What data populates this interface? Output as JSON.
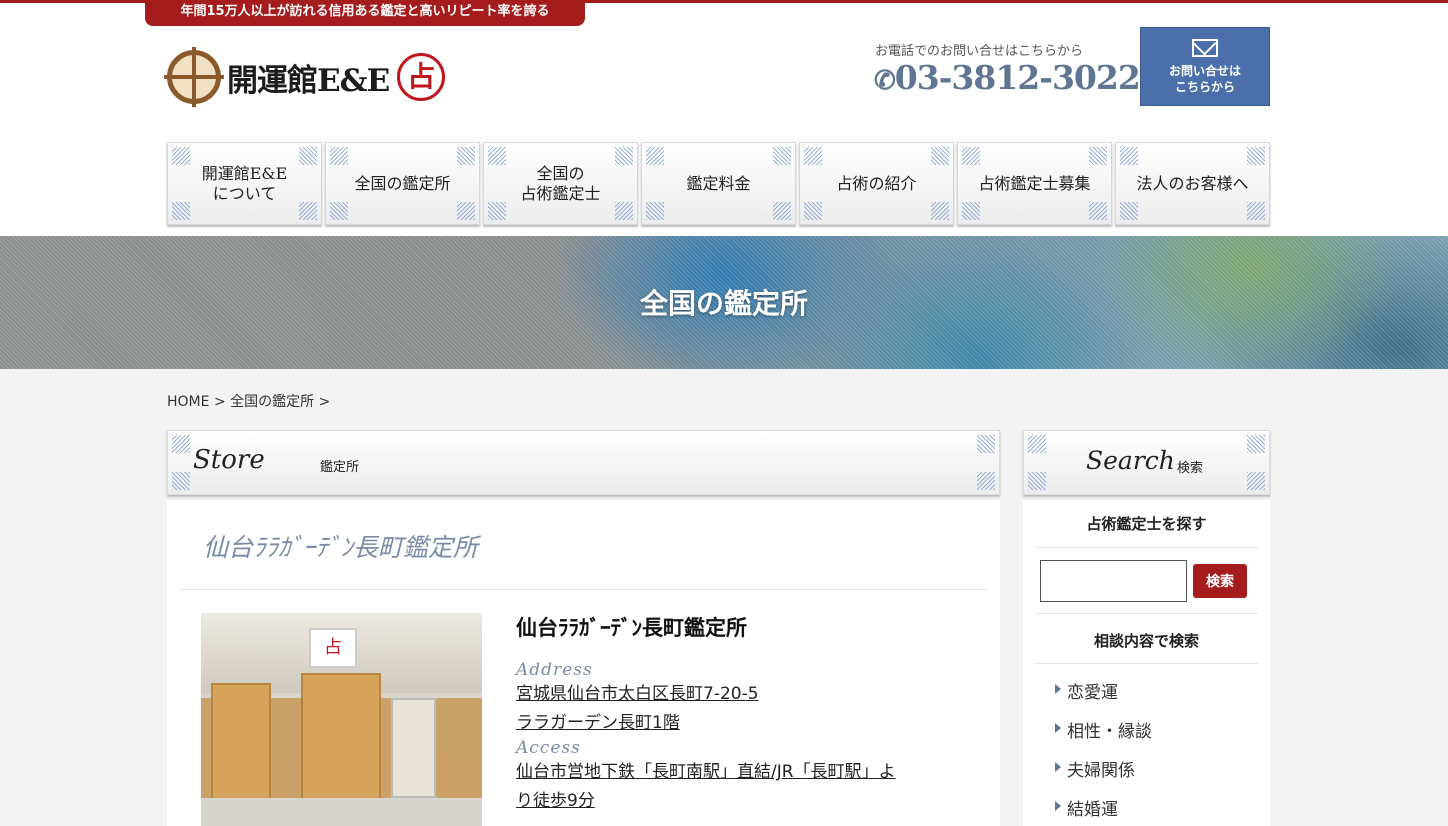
{
  "header": {
    "tagline": "年間15万人以上が訪れる信用ある鑑定と高いリピート率を誇る",
    "logo_text": "開運館E&E",
    "logo_seal": "占",
    "phone_caption": "お電話でのお問い合せはこちらから",
    "phone_number": "03-3812-3022",
    "contact_button_line1": "お問い合せは",
    "contact_button_line2": "こちらから"
  },
  "nav": {
    "items": [
      {
        "label": "開運館E&E\nについて"
      },
      {
        "label": "全国の鑑定所"
      },
      {
        "label": "全国の\n占術鑑定士"
      },
      {
        "label": "鑑定料金"
      },
      {
        "label": "占術の紹介"
      },
      {
        "label": "占術鑑定士募集"
      },
      {
        "label": "法人のお客様へ"
      }
    ]
  },
  "hero": {
    "title": "全国の鑑定所"
  },
  "breadcrumb": {
    "home": "HOME",
    "sep1": ">",
    "current": "全国の鑑定所",
    "sep2": ">"
  },
  "store_section": {
    "heading_en": "Store",
    "heading_ja": "鑑定所",
    "title": "仙台ﾗﾗｶﾞｰﾃﾞﾝ長町鑑定所",
    "photo_sign": "占",
    "name": "仙台ﾗﾗｶﾞｰﾃﾞﾝ長町鑑定所",
    "address_label": "Address",
    "address_line1": "宮城県仙台市太白区長町7-20-5",
    "address_line2": "ララガーデン長町1階",
    "access_label": "Access",
    "access_line1": "仙台市営地下鉄「長町南駅」直結/JR「長町駅」よ",
    "access_line2": "り徒歩9分"
  },
  "sidebar": {
    "heading_en": "Search",
    "heading_ja": "検索",
    "find_reader": "占術鑑定士を探す",
    "search_button": "検索",
    "search_value": "",
    "by_topic": "相談内容で検索",
    "topics": [
      {
        "label": "恋愛運"
      },
      {
        "label": "相性・縁談"
      },
      {
        "label": "夫婦関係"
      },
      {
        "label": "結婚運"
      }
    ]
  },
  "colors": {
    "brand_red": "#a51c1c",
    "accent_blue": "#5f7592",
    "title_blue_gray": "#7b8aa6"
  }
}
